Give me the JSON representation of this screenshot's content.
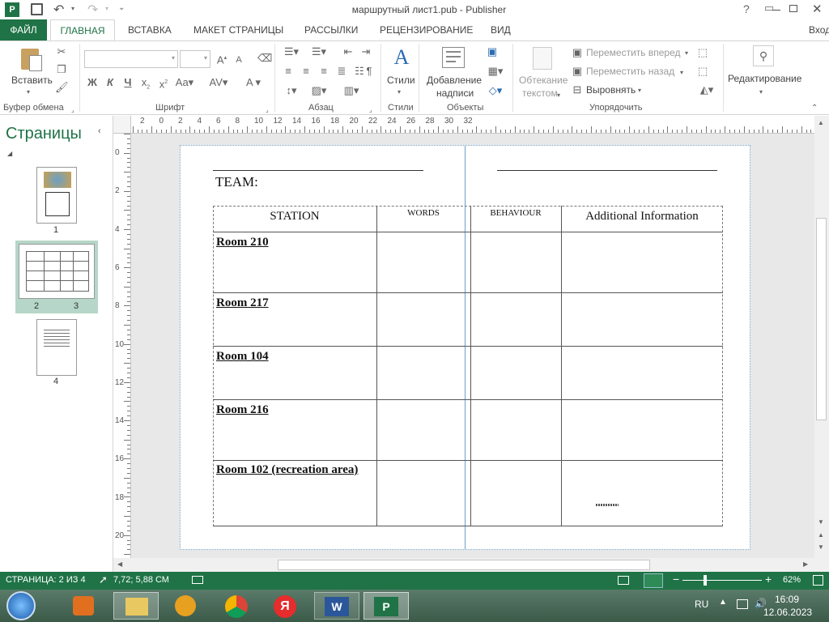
{
  "window": {
    "title": "маршрутный лист1.pub - Publisher",
    "help": "?",
    "signin": "Вход"
  },
  "ribbon_tabs": [
    "ФАЙЛ",
    "ГЛАВНАЯ",
    "ВСТАВКА",
    "МАКЕТ СТРАНИЦЫ",
    "РАССЫЛКИ",
    "РЕЦЕНЗИРОВАНИЕ",
    "ВИД"
  ],
  "ribbon": {
    "paste": "Вставить",
    "clipboard_group": "Буфер обмена",
    "font_group": "Шрифт",
    "paragraph_group": "Абзац",
    "styles": "Стили",
    "styles_group": "Стили",
    "textbox_line1": "Добавление",
    "textbox_line2": "надписи",
    "objects_group": "Объекты",
    "wrap_line1": "Обтекание",
    "wrap_line2": "текстом",
    "bring_forward": "Переместить вперед",
    "send_backward": "Переместить назад",
    "align": "Выровнять",
    "arrange_group": "Упорядочить",
    "editing": "Редактирование",
    "font_bold": "Ж",
    "font_italic": "К",
    "font_underline": "Ч"
  },
  "pages_pane": {
    "title": "Страницы",
    "page1": "1",
    "page2": "2",
    "page3": "3",
    "page4": "4"
  },
  "ruler_h": [
    "2",
    "0",
    "2",
    "4",
    "6",
    "8",
    "10",
    "12",
    "14",
    "16",
    "18",
    "20",
    "22",
    "24",
    "26",
    "28",
    "30",
    "32"
  ],
  "ruler_v": [
    "0",
    "2",
    "4",
    "6",
    "8",
    "10",
    "12",
    "14",
    "16",
    "18",
    "20"
  ],
  "document": {
    "team_label": "TEAM:",
    "columns": [
      "STATION",
      "WORDS",
      "BEHAVIOUR",
      "Additional Information"
    ],
    "rows": [
      "Room 210",
      "Room 217",
      "Room 104",
      "Room 216",
      "Room 102 (recreation area)"
    ]
  },
  "status": {
    "page": "СТРАНИЦА: 2 ИЗ 4",
    "position": "7,72; 5,88 СМ",
    "zoom": "62%"
  },
  "taskbar": {
    "lang": "RU",
    "time": "16:09",
    "date": "12.06.2023"
  },
  "colors": {
    "accent": "#1f7346",
    "statusbar": "#1f7346"
  }
}
